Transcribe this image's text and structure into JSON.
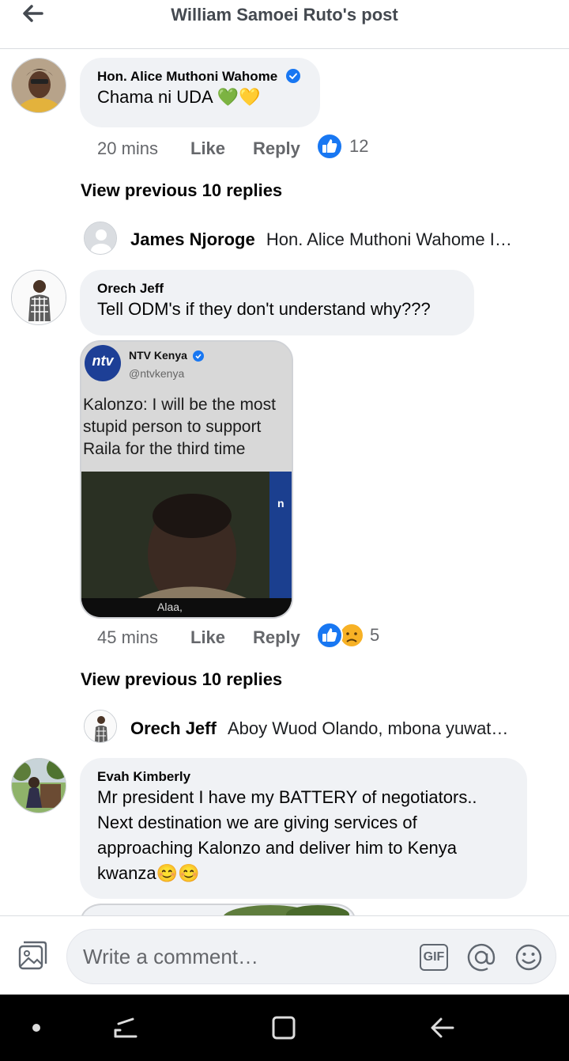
{
  "header": {
    "title": "William Samoei Ruto's post"
  },
  "comments": [
    {
      "author": "Hon. Alice Muthoni Wahome",
      "text": "Chama ni UDA 💚💛",
      "time": "20 mins",
      "like_label": "Like",
      "reply_label": "Reply",
      "reactions": "12",
      "view_previous": "View previous 10 replies",
      "latest_reply": {
        "author": "James Njoroge",
        "text": "Hon. Alice Muthoni Wahome I…"
      }
    },
    {
      "author": "Orech Jeff",
      "text": "Tell ODM's if they don't understand why???",
      "time": "45 mins",
      "like_label": "Like",
      "reply_label": "Reply",
      "reactions": "5",
      "view_previous": "View previous 10 replies",
      "latest_reply": {
        "author": "Orech Jeff",
        "text": "Aboy Wuod Olando, mbona yuwat…"
      },
      "attachment": {
        "account_name": "NTV Kenya",
        "handle": "@ntvkenya",
        "logo_text": "ntv",
        "headline_1": "Kalonzo: I will be the most",
        "headline_2": "stupid person to support",
        "headline_3": "Raila  for the third time",
        "caption": "Alaa,"
      }
    },
    {
      "author": "Evah Kimberly",
      "text_1": "Mr president I have my BATTERY of negotiators..",
      "text_2": "Next destination we are giving services of",
      "text_3": "approaching Kalonzo and deliver him to Kenya",
      "text_4": "kwanza😊😊"
    }
  ],
  "composer": {
    "placeholder": "Write a comment…",
    "gif_label": "GIF"
  },
  "colors": {
    "like_blue": "#1877f2",
    "bubble_bg": "#f0f2f5",
    "verified_blue": "#1877f2"
  }
}
